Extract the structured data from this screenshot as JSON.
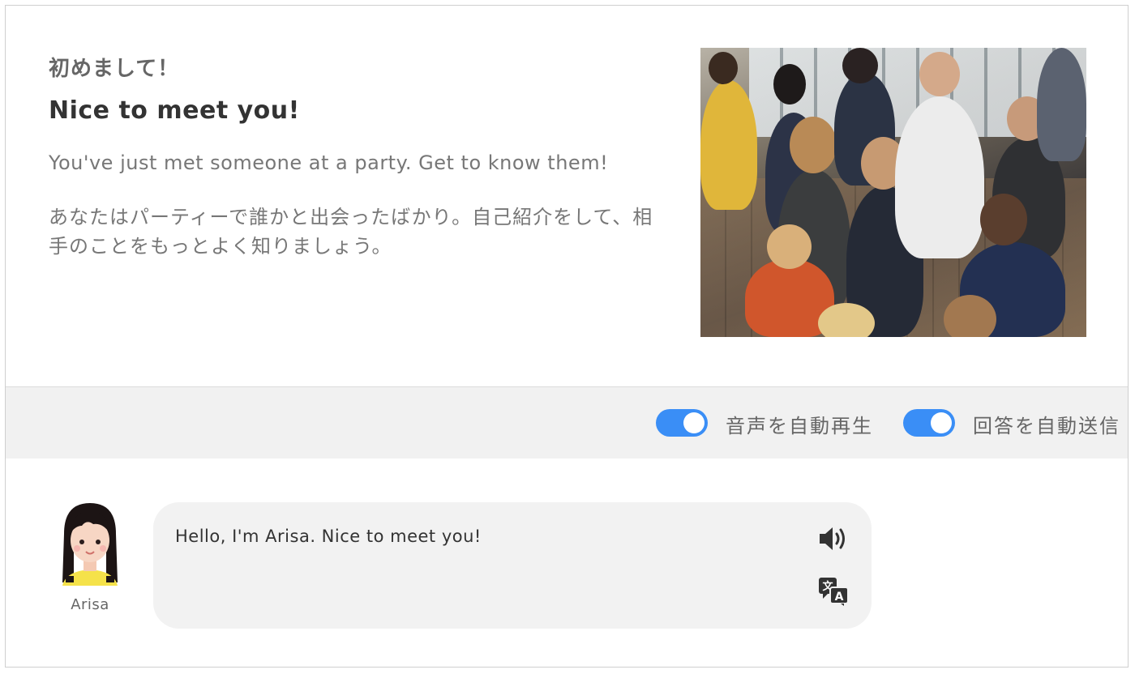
{
  "scenario": {
    "title_ja": "初めまして！",
    "title_en": "Nice to meet you!",
    "description_en": "You've just met someone at a party. Get to know them!",
    "description_ja": "あなたはパーティーで誰かと出会ったばかり。自己紹介をして、相手のことをもっとよく知りましょう。",
    "image": "party-crowd-photo"
  },
  "settings": {
    "autoplay_audio": {
      "label": "音声を自動再生",
      "enabled": true
    },
    "auto_send_answer": {
      "label": "回答を自動送信",
      "enabled": true
    },
    "toggle_color": "#3a8ef6"
  },
  "chat": {
    "messages": [
      {
        "speaker": "Arisa",
        "text": "Hello, I'm Arisa. Nice to meet you!",
        "icons": [
          "speaker-icon",
          "translate-icon"
        ]
      }
    ]
  }
}
